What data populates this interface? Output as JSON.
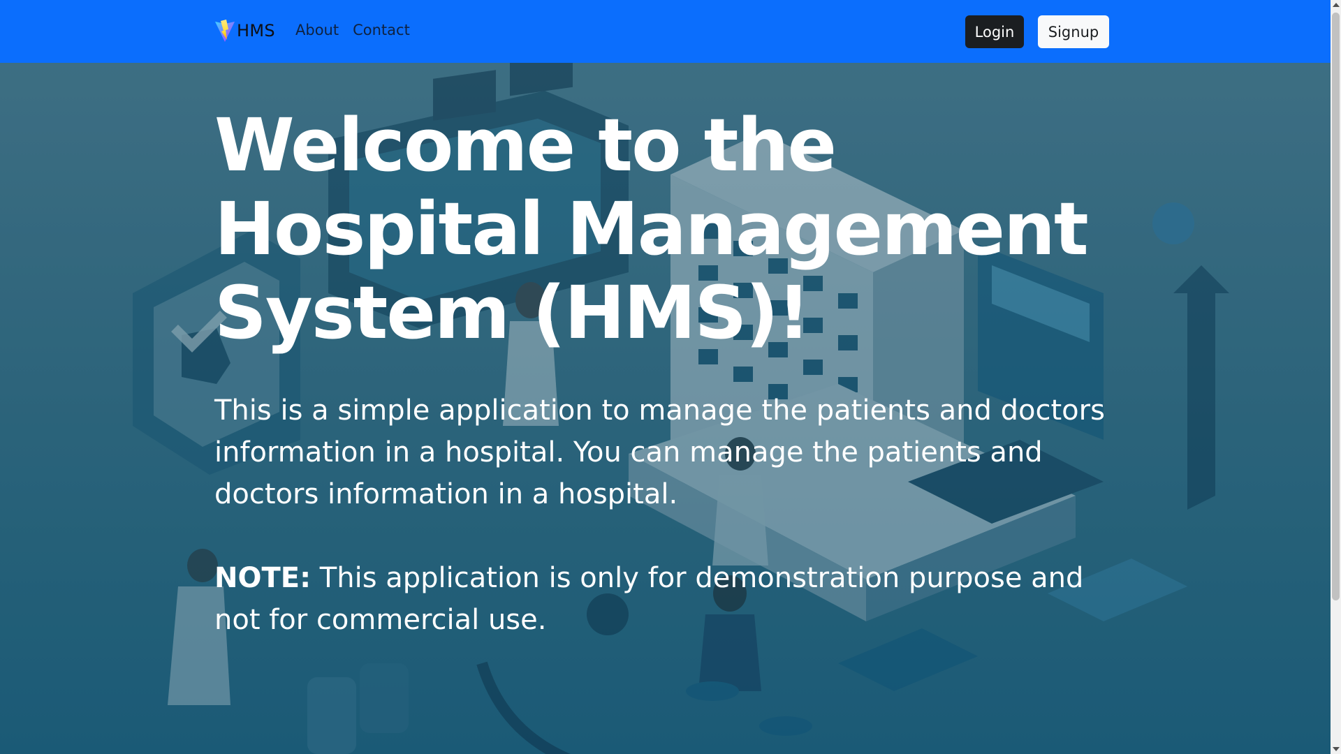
{
  "navbar": {
    "brand": "HMS",
    "logo_icon": "vite-lightning-logo",
    "links": [
      {
        "label": "About"
      },
      {
        "label": "Contact"
      }
    ],
    "login_label": "Login",
    "signup_label": "Signup",
    "bg_color": "#0b6efd"
  },
  "hero": {
    "title": "Welcome to the Hospital Management System (HMS)!",
    "description": "This is a simple application to manage the patients and doctors information in a hospital. You can manage the patients and doctors information in a hospital.",
    "note_label": "NOTE:",
    "note_text": " This application is only for demonstration purpose and not for commercial use.",
    "background_image": "isometric-hospital-illustration"
  }
}
